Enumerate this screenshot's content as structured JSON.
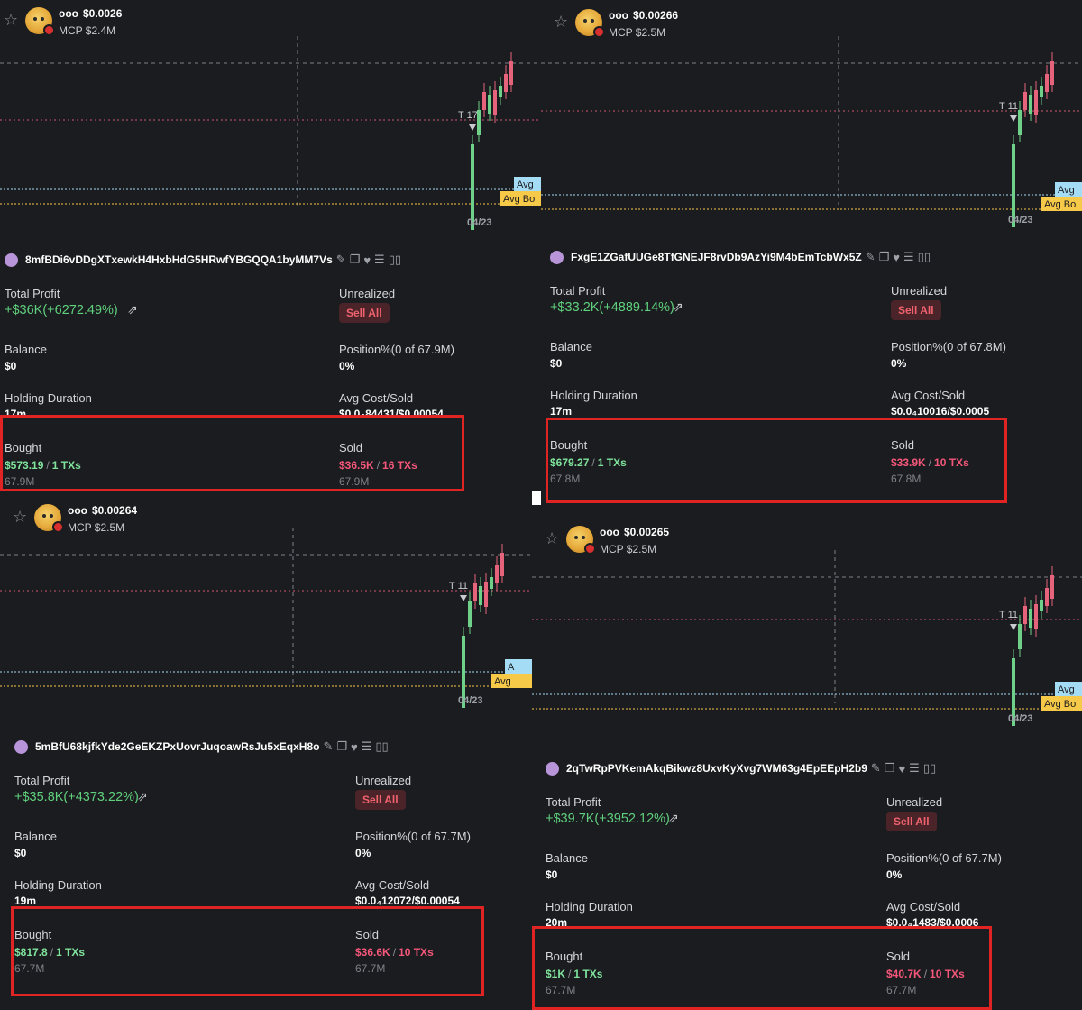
{
  "colors": {
    "panel_bg": "#1b1c1f",
    "profit_green": "#5fd07d",
    "sold_red": "#f4577a",
    "sell_all_bg": "#4a2428",
    "avg_buy_tag": "#f7c948",
    "avg_tag": "#a5dcf5",
    "highlight_box": "#e02424"
  },
  "panels": [
    {
      "header": {
        "token": "ooo",
        "price": "$0.0026",
        "mcp": "MCP $2.4M"
      },
      "chart": {
        "date_label": "04/23",
        "marker_label": "T 17",
        "avg_tag": "Avg",
        "avg_buy_tag": "Avg Bo"
      },
      "wallet": "8mfBDi6vDDgXTxewkH4HxbHdG5HRwfYBGQQA1byMM7Vs",
      "labels": {
        "total_profit": "Total Profit",
        "unrealized": "Unrealized",
        "balance": "Balance",
        "position": "Position%(0 of 67.9M)",
        "holding": "Holding Duration",
        "avg_cost": "Avg Cost/Sold",
        "bought": "Bought",
        "sold": "Sold"
      },
      "profit": "+$36K(+6272.49%)",
      "sell_all": "Sell All",
      "balance": "$0",
      "position": "0%",
      "holding": "17m",
      "avg_cost": "$0.0₄84431/$0.00054",
      "bought_amount": "$573.19",
      "bought_txs": "1 TXs",
      "bought_tokens": "67.9M",
      "sold_amount": "$36.5K",
      "sold_txs": "16 TXs",
      "sold_tokens": "67.9M"
    },
    {
      "header": {
        "token": "ooo",
        "price": "$0.00266",
        "mcp": "MCP $2.5M"
      },
      "chart": {
        "date_label": "04/23",
        "marker_label": "T 11",
        "avg_tag": "Avg",
        "avg_buy_tag": "Avg Bo"
      },
      "wallet": "FxgE1ZGafUUGe8TfGNEJF8rvDb9AzYi9M4bEmTcbWx5Z",
      "labels": {
        "total_profit": "Total Profit",
        "unrealized": "Unrealized",
        "balance": "Balance",
        "position": "Position%(0 of 67.8M)",
        "holding": "Holding Duration",
        "avg_cost": "Avg Cost/Sold",
        "bought": "Bought",
        "sold": "Sold"
      },
      "profit": "+$33.2K(+4889.14%)",
      "sell_all": "Sell All",
      "balance": "$0",
      "position": "0%",
      "holding": "17m",
      "avg_cost": "$0.0₄10016/$0.0005",
      "bought_amount": "$679.27",
      "bought_txs": "1 TXs",
      "bought_tokens": "67.8M",
      "sold_amount": "$33.9K",
      "sold_txs": "10 TXs",
      "sold_tokens": "67.8M"
    },
    {
      "header": {
        "token": "ooo",
        "price": "$0.00264",
        "mcp": "MCP $2.5M"
      },
      "chart": {
        "date_label": "04/23",
        "marker_label": "T 11",
        "avg_tag": "A",
        "avg_buy_tag": "Avg"
      },
      "wallet": "5mBfU68kjfkYde2GeEKZPxUovrJuqoawRsJu5xEqxH8o",
      "labels": {
        "total_profit": "Total Profit",
        "unrealized": "Unrealized",
        "balance": "Balance",
        "position": "Position%(0 of 67.7M)",
        "holding": "Holding Duration",
        "avg_cost": "Avg Cost/Sold",
        "bought": "Bought",
        "sold": "Sold"
      },
      "profit": "+$35.8K(+4373.22%)",
      "sell_all": "Sell All",
      "balance": "$0",
      "position": "0%",
      "holding": "19m",
      "avg_cost": "$0.0₄12072/$0.00054",
      "bought_amount": "$817.8",
      "bought_txs": "1 TXs",
      "bought_tokens": "67.7M",
      "sold_amount": "$36.6K",
      "sold_txs": "10 TXs",
      "sold_tokens": "67.7M"
    },
    {
      "header": {
        "token": "ooo",
        "price": "$0.00265",
        "mcp": "MCP $2.5M"
      },
      "chart": {
        "date_label": "04/23",
        "marker_label": "T 11",
        "avg_tag": "Avg",
        "avg_buy_tag": "Avg Bo"
      },
      "wallet": "2qTwRpPVKemAkqBikwz8UxvKyXvg7WM63g4EpEEpH2b9",
      "labels": {
        "total_profit": "Total Profit",
        "unrealized": "Unrealized",
        "balance": "Balance",
        "position": "Position%(0 of 67.7M)",
        "holding": "Holding Duration",
        "avg_cost": "Avg Cost/Sold",
        "bought": "Bought",
        "sold": "Sold"
      },
      "profit": "+$39.7K(+3952.12%)",
      "sell_all": "Sell All",
      "balance": "$0",
      "position": "0%",
      "holding": "20m",
      "avg_cost": "$0.0₄1483/$0.0006",
      "bought_amount": "$1K",
      "bought_txs": "1 TXs",
      "bought_tokens": "67.7M",
      "sold_amount": "$40.7K",
      "sold_txs": "10 TXs",
      "sold_tokens": "67.7M"
    }
  ]
}
